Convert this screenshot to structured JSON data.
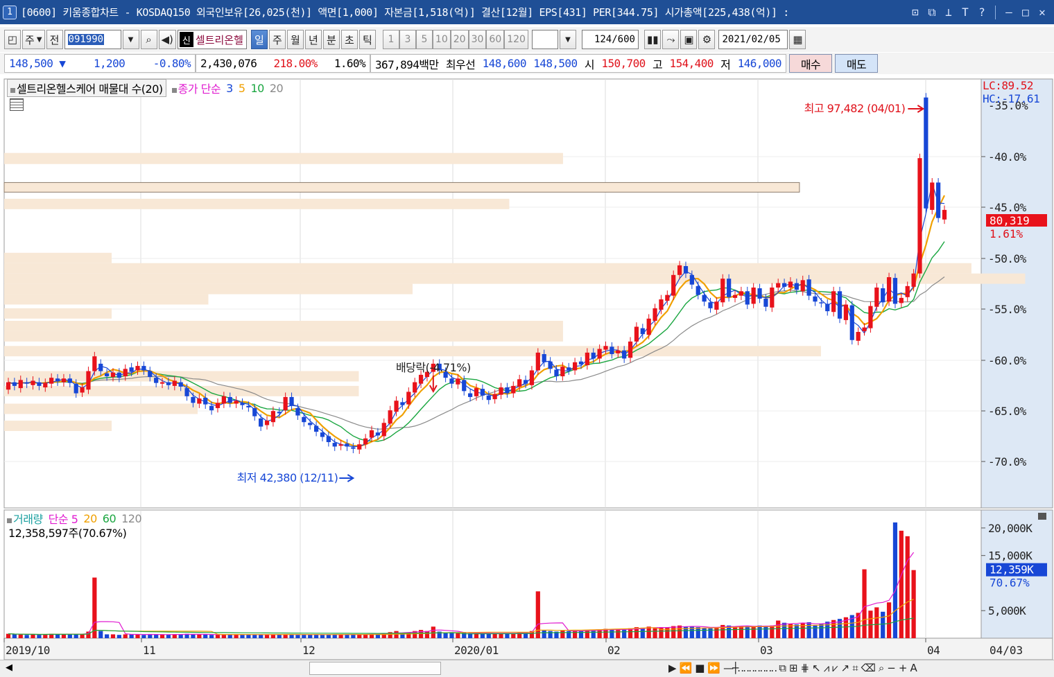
{
  "window": {
    "number": "1",
    "title": "[0600] 키움종합차트 - KOSDAQ150 외국인보유[26,025(천)] 액면[1,000] 자본금[1,518(억)] 결산[12월] EPS[431] PER[344.75] 시가총액[225,438(억)] :"
  },
  "toolbar": {
    "type_label": "주",
    "prev_label": "전",
    "code": "091990",
    "badge": "신",
    "stock_name": "셀트리온헬",
    "periods": [
      "일",
      "주",
      "월",
      "년",
      "분",
      "초",
      "틱"
    ],
    "selected_period": "일",
    "intervals": [
      "1",
      "3",
      "5",
      "10",
      "20",
      "30",
      "60",
      "120"
    ],
    "count": "124",
    "count_total": "/600",
    "date": "2021/02/05"
  },
  "quote": {
    "price": "148,500",
    "change": "1,200",
    "change_pct": "-0.80%",
    "volume": "2,430,076",
    "vol_ratio": "218.00%",
    "turnover": "1.60%",
    "amount": "367,894백만",
    "best_label": "최우선",
    "ask": "148,600",
    "bid": "148,500",
    "open_label": "시",
    "open": "150,700",
    "high_label": "고",
    "high": "154,400",
    "low_label": "저",
    "low": "146,000",
    "buy_label": "매수",
    "sell_label": "매도"
  },
  "price_panel": {
    "legend_title": "셀트리온헬스케어 매물대 수(20)",
    "legend_ma": "종가 단순",
    "ma_periods": [
      "3",
      "5",
      "10",
      "20"
    ],
    "lc": "LC:89.52",
    "hc": "HC:-17.61",
    "y_ticks": [
      "-40.0%",
      "-45.0%",
      "-50.0%",
      "-55.0%",
      "-60.0%",
      "-65.0%",
      "-70.0%"
    ],
    "top_tick_partial": "-35.0%",
    "current_value": "80,319",
    "current_pct": "1.61%",
    "annotations": {
      "high": "최고 97,482 (04/01)",
      "low": "최저 42,380 (12/11)",
      "dividend": "배당락(-4.71%)"
    }
  },
  "volume_panel": {
    "legend_title": "거래량",
    "legend_ma": "단순",
    "ma_periods": [
      "5",
      "20",
      "60",
      "120"
    ],
    "value_text": "12,358,597주(70.67%)",
    "y_ticks": [
      "20,000K",
      "15,000K",
      "5,000K"
    ],
    "current_value": "12,359K",
    "current_pct": "70.67%"
  },
  "x_axis": {
    "labels": [
      "2019/10",
      "11",
      "12",
      "2020/01",
      "02",
      "03",
      "04"
    ],
    "right_label": "04/03"
  },
  "colors": {
    "up": "#e8121b",
    "down": "#1747d6",
    "ma3": "#1747d6",
    "ma5": "#f0a000",
    "ma10": "#1aa640",
    "ma20": "#8a8a8a",
    "vol_ma5": "#e01bd0",
    "profile": "#f8e8d6",
    "titlebar": "#1f4f96"
  },
  "chart_data": {
    "type": "candlestick",
    "price_range": [
      40000,
      98000
    ],
    "volume_range_k": [
      0,
      22000
    ],
    "candles": [
      {
        "o": 56000,
        "c": 57000
      },
      {
        "o": 57000,
        "c": 56500
      },
      {
        "o": 56200,
        "c": 57300
      },
      {
        "o": 57000,
        "c": 56800
      },
      {
        "o": 56600,
        "c": 57200
      },
      {
        "o": 57000,
        "c": 56500
      },
      {
        "o": 56300,
        "c": 56900
      },
      {
        "o": 56800,
        "c": 57600
      },
      {
        "o": 57500,
        "c": 57100
      },
      {
        "o": 57000,
        "c": 57500
      },
      {
        "o": 57500,
        "c": 56900
      },
      {
        "o": 56800,
        "c": 55500
      },
      {
        "o": 55600,
        "c": 56300
      },
      {
        "o": 56000,
        "c": 58500
      },
      {
        "o": 58500,
        "c": 60500
      },
      {
        "o": 59500,
        "c": 58500
      },
      {
        "o": 58200,
        "c": 57800
      },
      {
        "o": 57700,
        "c": 58300
      },
      {
        "o": 58300,
        "c": 57600
      },
      {
        "o": 57800,
        "c": 58800
      },
      {
        "o": 59000,
        "c": 58400
      },
      {
        "o": 58600,
        "c": 59200
      },
      {
        "o": 59200,
        "c": 58600
      },
      {
        "o": 58500,
        "c": 57700
      },
      {
        "o": 57600,
        "c": 56900
      },
      {
        "o": 56800,
        "c": 57000
      },
      {
        "o": 57000,
        "c": 56600
      },
      {
        "o": 56500,
        "c": 57200
      },
      {
        "o": 57000,
        "c": 56400
      },
      {
        "o": 56200,
        "c": 55100
      },
      {
        "o": 55000,
        "c": 54200
      },
      {
        "o": 54100,
        "c": 54800
      },
      {
        "o": 54900,
        "c": 54000
      },
      {
        "o": 53800,
        "c": 53200
      },
      {
        "o": 53500,
        "c": 54200
      },
      {
        "o": 54100,
        "c": 55100
      },
      {
        "o": 55000,
        "c": 54200
      },
      {
        "o": 54100,
        "c": 54500
      },
      {
        "o": 54200,
        "c": 53900
      },
      {
        "o": 53800,
        "c": 53600
      },
      {
        "o": 53500,
        "c": 52400
      },
      {
        "o": 52100,
        "c": 51000
      },
      {
        "o": 51200,
        "c": 51800
      },
      {
        "o": 51600,
        "c": 53100
      },
      {
        "o": 53000,
        "c": 52800
      },
      {
        "o": 53200,
        "c": 55000
      },
      {
        "o": 55000,
        "c": 53800
      },
      {
        "o": 53500,
        "c": 52500
      },
      {
        "o": 52300,
        "c": 51600
      },
      {
        "o": 51500,
        "c": 51200
      },
      {
        "o": 51100,
        "c": 50300
      },
      {
        "o": 50200,
        "c": 49600
      },
      {
        "o": 49700,
        "c": 48900
      },
      {
        "o": 48800,
        "c": 48300
      },
      {
        "o": 48400,
        "c": 48600
      },
      {
        "o": 48700,
        "c": 48300
      },
      {
        "o": 48200,
        "c": 48000
      },
      {
        "o": 47900,
        "c": 48600
      },
      {
        "o": 48600,
        "c": 49400
      },
      {
        "o": 49500,
        "c": 50500
      },
      {
        "o": 50200,
        "c": 49800
      },
      {
        "o": 49700,
        "c": 51500
      },
      {
        "o": 51400,
        "c": 53200
      },
      {
        "o": 53000,
        "c": 54500
      },
      {
        "o": 54300,
        "c": 53900
      },
      {
        "o": 54000,
        "c": 55700
      },
      {
        "o": 55600,
        "c": 57000
      },
      {
        "o": 56800,
        "c": 58000
      },
      {
        "o": 57700,
        "c": 58400
      },
      {
        "o": 58400,
        "c": 59500
      },
      {
        "o": 59500,
        "c": 58600
      },
      {
        "o": 58400,
        "c": 57600
      },
      {
        "o": 57500,
        "c": 56800
      },
      {
        "o": 56700,
        "c": 57500
      },
      {
        "o": 57300,
        "c": 55800
      },
      {
        "o": 55500,
        "c": 55000
      },
      {
        "o": 55100,
        "c": 56200
      },
      {
        "o": 56100,
        "c": 55200
      },
      {
        "o": 55200,
        "c": 54600
      },
      {
        "o": 54700,
        "c": 55400
      },
      {
        "o": 55300,
        "c": 56300
      },
      {
        "o": 56300,
        "c": 55500
      },
      {
        "o": 55500,
        "c": 56500
      },
      {
        "o": 56400,
        "c": 57400
      },
      {
        "o": 57300,
        "c": 56800
      },
      {
        "o": 56600,
        "c": 58600
      },
      {
        "o": 58600,
        "c": 61000
      },
      {
        "o": 60800,
        "c": 59700
      },
      {
        "o": 59800,
        "c": 58800
      },
      {
        "o": 58700,
        "c": 57800
      },
      {
        "o": 57800,
        "c": 59100
      },
      {
        "o": 59000,
        "c": 58600
      },
      {
        "o": 58600,
        "c": 59700
      },
      {
        "o": 59800,
        "c": 59400
      },
      {
        "o": 59300,
        "c": 61000
      },
      {
        "o": 61000,
        "c": 60200
      },
      {
        "o": 60200,
        "c": 61500
      },
      {
        "o": 61400,
        "c": 61900
      },
      {
        "o": 61800,
        "c": 60800
      },
      {
        "o": 60900,
        "c": 61300
      },
      {
        "o": 61300,
        "c": 60200
      },
      {
        "o": 60300,
        "c": 62500
      },
      {
        "o": 62500,
        "c": 64500
      },
      {
        "o": 64300,
        "c": 63500
      },
      {
        "o": 63400,
        "c": 65600
      },
      {
        "o": 65300,
        "c": 67000
      },
      {
        "o": 66800,
        "c": 68200
      },
      {
        "o": 68000,
        "c": 68800
      },
      {
        "o": 68700,
        "c": 71500
      },
      {
        "o": 71500,
        "c": 72800
      },
      {
        "o": 72700,
        "c": 71700
      },
      {
        "o": 71500,
        "c": 70200
      },
      {
        "o": 70000,
        "c": 68800
      },
      {
        "o": 68800,
        "c": 67900
      },
      {
        "o": 67800,
        "c": 67000
      },
      {
        "o": 66800,
        "c": 67900
      },
      {
        "o": 67800,
        "c": 71000
      },
      {
        "o": 71000,
        "c": 68500
      },
      {
        "o": 68400,
        "c": 68800
      },
      {
        "o": 68700,
        "c": 69300
      },
      {
        "o": 69300,
        "c": 67500
      },
      {
        "o": 67600,
        "c": 69800
      },
      {
        "o": 69700,
        "c": 68300
      },
      {
        "o": 68300,
        "c": 67200
      },
      {
        "o": 67100,
        "c": 69800
      },
      {
        "o": 69800,
        "c": 70400
      },
      {
        "o": 70400,
        "c": 69900
      },
      {
        "o": 69800,
        "c": 70600
      },
      {
        "o": 70400,
        "c": 69500
      },
      {
        "o": 69300,
        "c": 70800
      },
      {
        "o": 70900,
        "c": 68700
      },
      {
        "o": 68600,
        "c": 67900
      },
      {
        "o": 67800,
        "c": 67700
      },
      {
        "o": 67600,
        "c": 66600
      },
      {
        "o": 66500,
        "c": 69300
      },
      {
        "o": 69300,
        "c": 65600
      },
      {
        "o": 65400,
        "c": 67500
      },
      {
        "o": 67400,
        "c": 62700
      },
      {
        "o": 62600,
        "c": 63800
      },
      {
        "o": 63900,
        "c": 64400
      },
      {
        "o": 64300,
        "c": 67300
      },
      {
        "o": 67200,
        "c": 69800
      },
      {
        "o": 69700,
        "c": 67800
      },
      {
        "o": 67900,
        "c": 71200
      },
      {
        "o": 71100,
        "c": 67600
      },
      {
        "o": 67700,
        "c": 68400
      },
      {
        "o": 68500,
        "c": 70000
      },
      {
        "o": 69900,
        "c": 71700
      },
      {
        "o": 71700,
        "c": 87300
      },
      {
        "o": 95500,
        "c": 80500
      },
      {
        "o": 80300,
        "c": 84000
      },
      {
        "o": 84000,
        "c": 79200
      },
      {
        "o": 79000,
        "c": 80300
      }
    ],
    "volumes_k": [
      800,
      700,
      700,
      600,
      700,
      650,
      700,
      800,
      700,
      750,
      750,
      700,
      800,
      1200,
      11000,
      1300,
      700,
      700,
      600,
      700,
      750,
      700,
      600,
      700,
      650,
      700,
      650,
      700,
      700,
      800,
      650,
      700,
      650,
      600,
      650,
      700,
      650,
      700,
      600,
      650,
      650,
      700,
      650,
      700,
      700,
      700,
      650,
      600,
      700,
      650,
      650,
      600,
      700,
      650,
      650,
      700,
      700,
      650,
      700,
      750,
      700,
      900,
      1100,
      1300,
      900,
      1000,
      1300,
      1500,
      1300,
      2100,
      1200,
      1000,
      1100,
      900,
      1000,
      900,
      850,
      950,
      900,
      850,
      900,
      950,
      900,
      1000,
      1100,
      1300,
      8500,
      1500,
      1300,
      1200,
      1400,
      1300,
      1400,
      1300,
      1500,
      1400,
      1600,
      1700,
      1600,
      1500,
      1500,
      1800,
      2000,
      1900,
      2100,
      1800,
      1900,
      2000,
      2200,
      2300,
      2100,
      2100,
      2000,
      1900,
      1800,
      2000,
      2400,
      2300,
      2100,
      2200,
      2200,
      2100,
      2300,
      2200,
      2300,
      3200,
      2800,
      2600,
      2500,
      2700,
      2900,
      2400,
      2600,
      3000,
      3300,
      3500,
      3800,
      4200,
      4600,
      12500,
      5000,
      5600,
      4800,
      6500,
      21000,
      19500,
      18500,
      12359
    ],
    "volume_down_flags": "auto",
    "price_profile_rows": [
      {
        "from": 88000,
        "to": 86500,
        "len": 0.52
      },
      {
        "from": 84000,
        "to": 82700,
        "len": 0.74
      },
      {
        "from": 81800,
        "to": 80400,
        "len": 0.47
      },
      {
        "from": 74500,
        "to": 73100,
        "len": 0.1
      },
      {
        "from": 73100,
        "to": 71700,
        "len": 0.9
      },
      {
        "from": 71700,
        "to": 70300,
        "len": 0.95
      },
      {
        "from": 70300,
        "to": 68900,
        "len": 0.38
      },
      {
        "from": 68900,
        "to": 67500,
        "len": 0.19
      },
      {
        "from": 67000,
        "to": 65600,
        "len": 0.1
      },
      {
        "from": 65300,
        "to": 63900,
        "len": 0.52
      },
      {
        "from": 63900,
        "to": 62500,
        "len": 0.52
      },
      {
        "from": 61900,
        "to": 60500,
        "len": 0.76
      },
      {
        "from": 58500,
        "to": 57100,
        "len": 0.33
      },
      {
        "from": 56500,
        "to": 55100,
        "len": 0.33
      },
      {
        "from": 54100,
        "to": 52700,
        "len": 0.18
      },
      {
        "from": 51800,
        "to": 50400,
        "len": 0.1
      }
    ]
  }
}
